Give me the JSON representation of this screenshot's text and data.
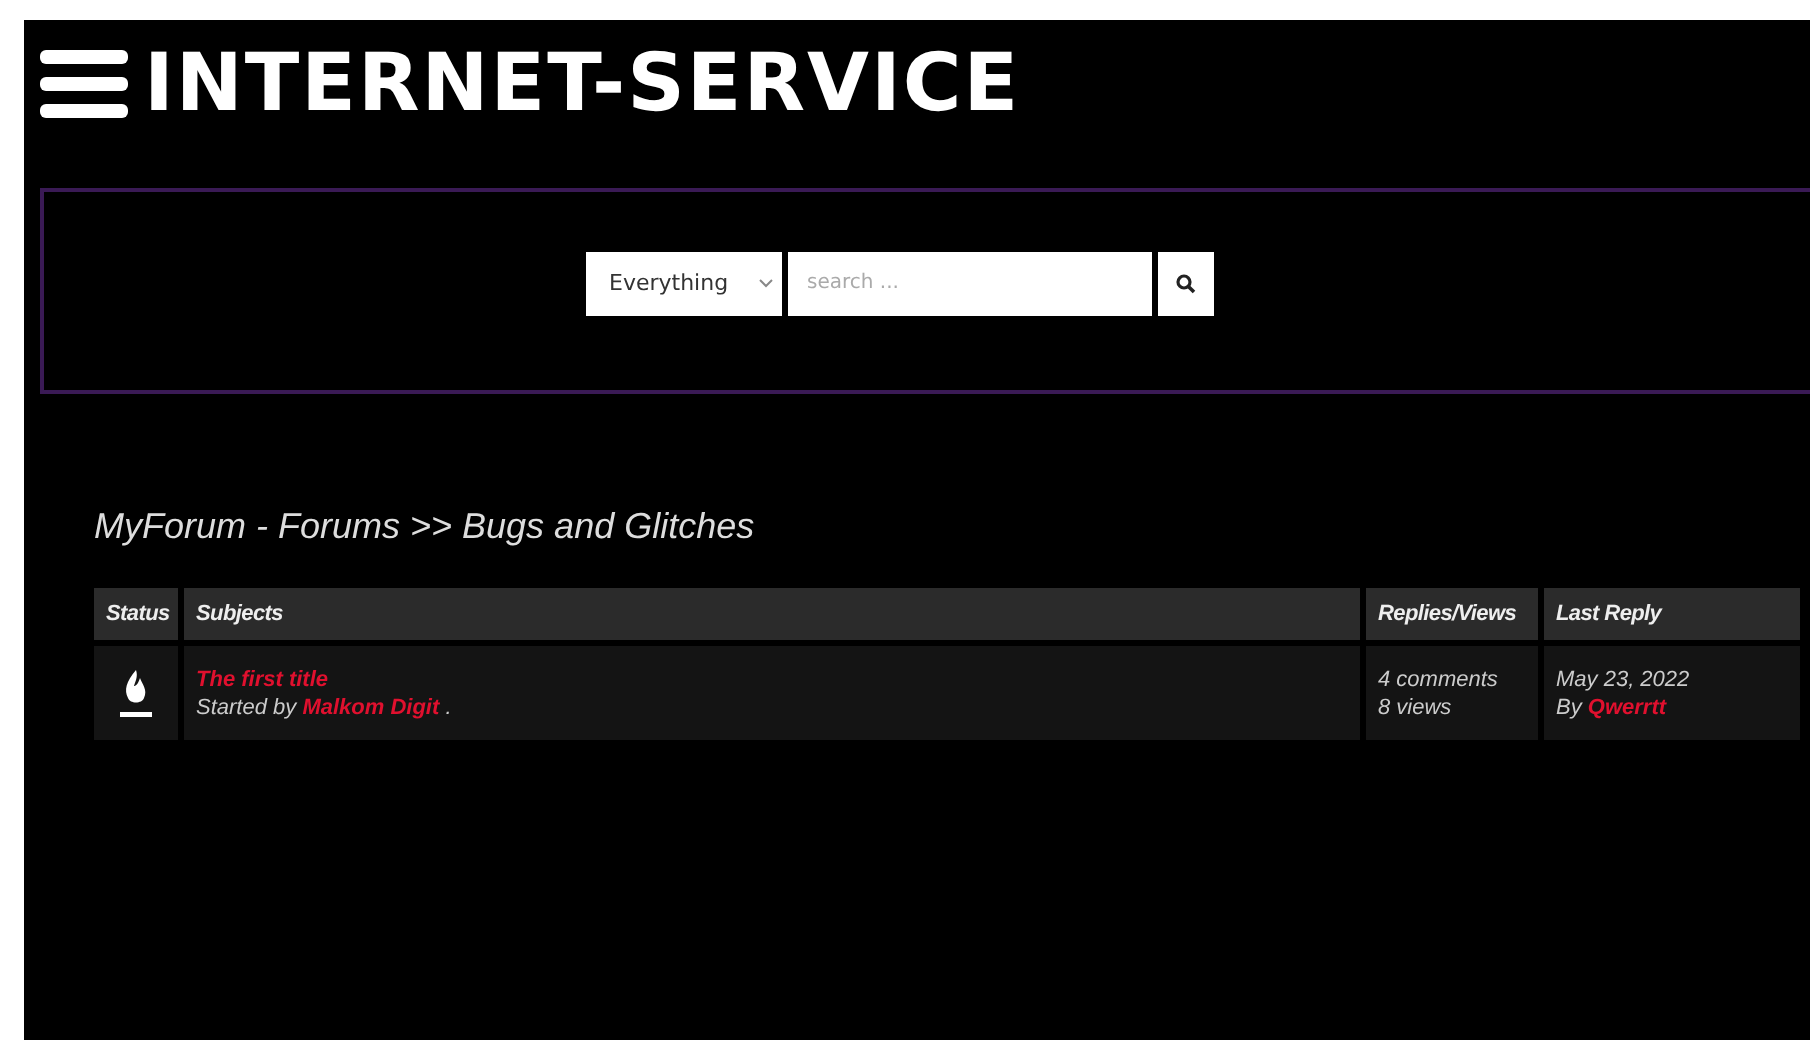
{
  "header": {
    "logo": "INTERNET-SERVICE"
  },
  "search": {
    "scope": "Everything",
    "placeholder": "search ..."
  },
  "breadcrumb": "MyForum - Forums >> Bugs and Glitches",
  "table": {
    "columns": [
      "Status",
      "Subjects",
      "Replies/Views",
      "Last Reply"
    ],
    "rows": [
      {
        "title": "The first title",
        "started_prefix": "Started by",
        "author": "Malkom Digit",
        "suffix": ".",
        "replies": "4 comments",
        "views": "8 views",
        "date": "May 23, 2022",
        "by_prefix": "By",
        "last_user": "Qwerrtt"
      }
    ]
  }
}
